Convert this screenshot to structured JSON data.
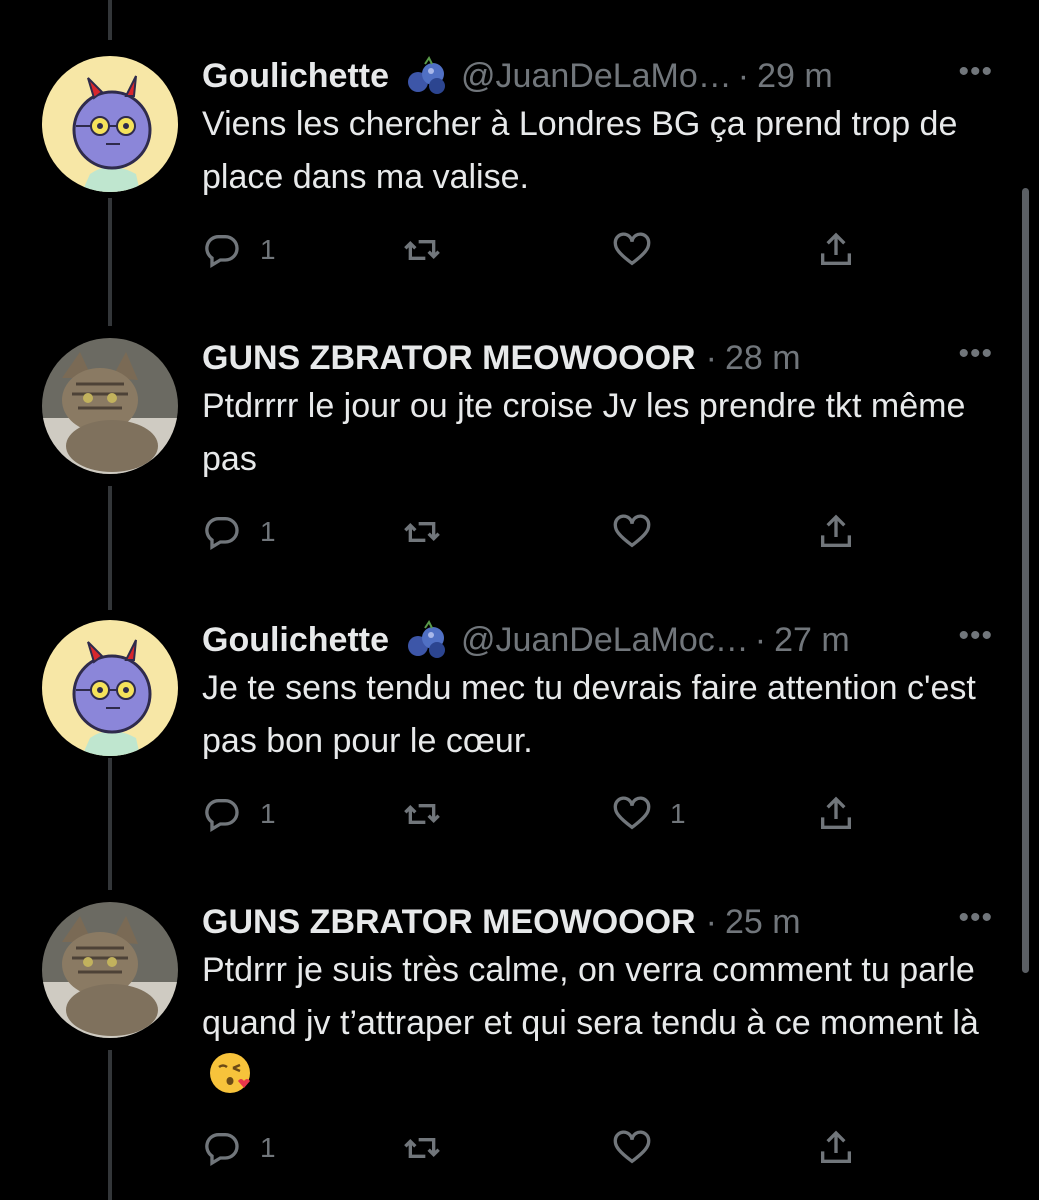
{
  "tweets": [
    {
      "author": "Goulichette",
      "handle": "@JuanDeLaMo…",
      "dot": "·",
      "time": "29 m",
      "avatar": "monster-avatar",
      "badge": "blueberry-icon",
      "text": "Viens les chercher à Londres BG ça prend trop de place dans ma valise.",
      "emoji": "",
      "reply_count": "1",
      "retweet_count": "",
      "like_count": "",
      "more": "•••"
    },
    {
      "author": "GUNS ZBRATOR MEOWOOOR",
      "handle": "",
      "dot": "·",
      "time": "28 m",
      "avatar": "cat-avatar",
      "badge": "",
      "text": "Ptdrrrr le jour ou jte croise Jv les prendre tkt même pas",
      "emoji": "",
      "reply_count": "1",
      "retweet_count": "",
      "like_count": "",
      "more": "•••"
    },
    {
      "author": "Goulichette",
      "handle": "@JuanDeLaMoc…",
      "dot": "·",
      "time": "27 m",
      "avatar": "monster-avatar",
      "badge": "blueberry-icon",
      "text": "Je te sens tendu mec tu devrais faire attention c'est pas bon pour le cœur.",
      "emoji": "",
      "reply_count": "1",
      "retweet_count": "",
      "like_count": "1",
      "more": "•••"
    },
    {
      "author": "GUNS ZBRATOR MEOWOOOR",
      "handle": "",
      "dot": "·",
      "time": "25 m",
      "avatar": "cat-avatar",
      "badge": "",
      "text": "Ptdrrr je suis très calme, on verra comment tu parle quand jv t’attraper et qui sera tendu à ce moment là",
      "emoji": "face-blowing-kiss-emoji",
      "reply_count": "1",
      "retweet_count": "",
      "like_count": "",
      "more": "•••"
    }
  ],
  "colors": {
    "background": "#000000",
    "text": "#e7e9ea",
    "muted": "#71767b",
    "thread_line": "#333639"
  }
}
